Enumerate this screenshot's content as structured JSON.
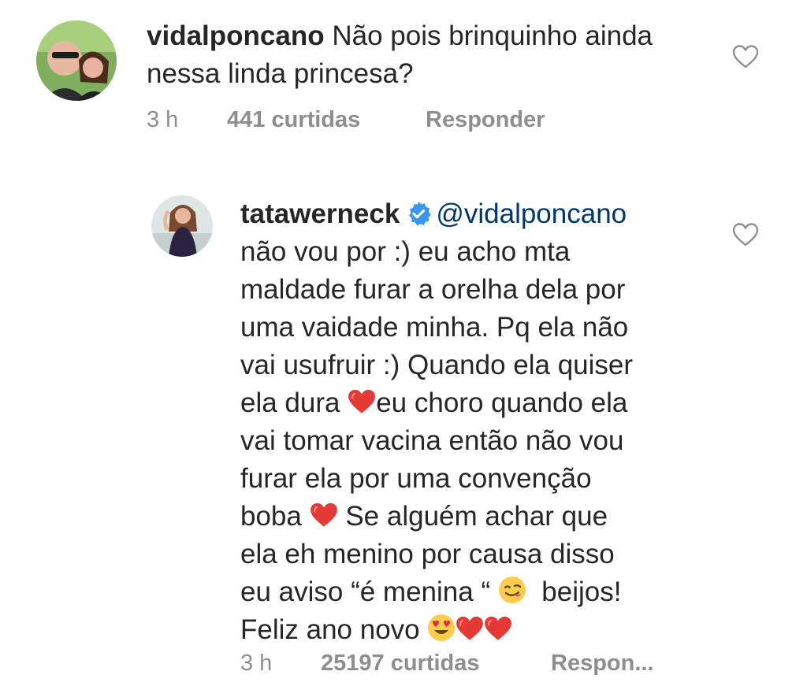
{
  "comments": [
    {
      "username": "vidalponcano",
      "text": "Não pois brinquinho ainda nessa linda princesa?",
      "time": "3 h",
      "likes": "441 curtidas",
      "reply": "Responder"
    }
  ],
  "reply": {
    "username": "tatawerneck",
    "verified": true,
    "mention": "@vidalponcano",
    "lines": [
      "não vou por :) eu acho mta",
      "maldade furar a orelha dela por",
      "uma vaidade minha. Pq ela não",
      "vai usufruir :) Quando ela quiser",
      "ela dura",
      "eu choro quando ela",
      "vai tomar vacina então não vou",
      "furar ela por uma convenção",
      "boba",
      " Se alguém achar que",
      "ela eh menino por causa disso",
      "eu aviso “é menina “",
      "beijos!",
      "Feliz ano novo"
    ],
    "time": "3 h",
    "likes": "25197 curtidas",
    "reply": "Respon..."
  },
  "icons": {
    "like": "heart-outline-icon",
    "verified": "verified-badge-icon",
    "emoji_heart": "red-heart-emoji",
    "emoji_yum": "face-savoring-food-emoji",
    "emoji_heart_eyes": "heart-eyes-emoji"
  },
  "colors": {
    "text": "#262626",
    "meta": "#8e8e8e",
    "mention": "#00376b",
    "verified": "#3897f0",
    "heart_emoji": "#e0245e"
  }
}
